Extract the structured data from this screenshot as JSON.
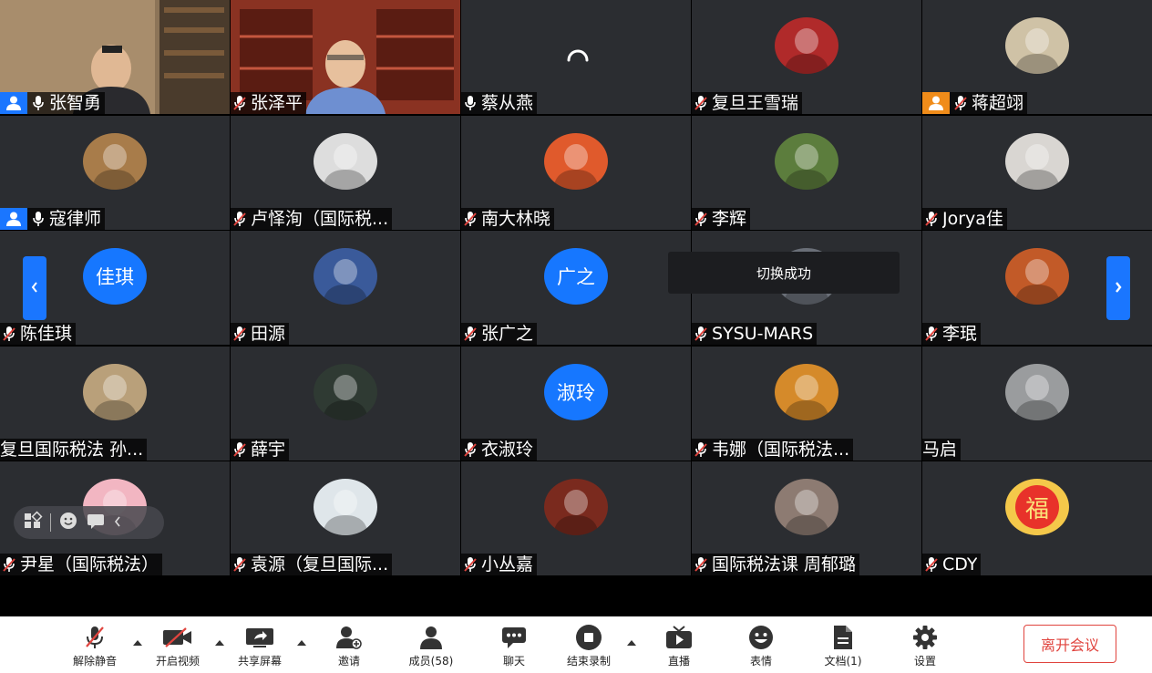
{
  "participants": [
    {
      "name": "张智勇",
      "host": "blue",
      "mic": "on",
      "media": "video1"
    },
    {
      "name": "张泽平",
      "host": "",
      "mic": "muted",
      "media": "video2"
    },
    {
      "name": "蔡从燕",
      "host": "",
      "mic": "on",
      "media": "loading"
    },
    {
      "name": "复旦王雪瑞",
      "host": "",
      "mic": "muted",
      "media": "avatar",
      "color": "#b02a2a"
    },
    {
      "name": "蒋超翊",
      "host": "orange",
      "mic": "muted",
      "media": "avatar",
      "color": "#cfc2a6"
    },
    {
      "name": "寇律师",
      "host": "blue",
      "mic": "on",
      "media": "avatar",
      "color": "#a87c4a"
    },
    {
      "name": "卢怿洵（国际税...",
      "host": "",
      "mic": "muted",
      "media": "avatar",
      "color": "#dddddd"
    },
    {
      "name": "南大林晓",
      "host": "",
      "mic": "muted",
      "media": "avatar",
      "color": "#e05a2c"
    },
    {
      "name": "李辉",
      "host": "",
      "mic": "muted",
      "media": "avatar",
      "color": "#5c7d3d"
    },
    {
      "name": "Jorya佳",
      "host": "",
      "mic": "muted",
      "media": "avatar",
      "color": "#d9d6d2"
    },
    {
      "name": "陈佳琪",
      "host": "",
      "mic": "muted",
      "media": "text",
      "text": "佳琪"
    },
    {
      "name": "田源",
      "host": "",
      "mic": "muted",
      "media": "avatar",
      "color": "#3a5a9a"
    },
    {
      "name": "张广之",
      "host": "",
      "mic": "muted",
      "media": "text",
      "text": "广之"
    },
    {
      "name": "SYSU-MARS",
      "host": "",
      "mic": "muted",
      "media": "avatar",
      "color": "#6a6f78"
    },
    {
      "name": "李珉",
      "host": "",
      "mic": "muted",
      "media": "avatar",
      "color": "#c25a28"
    },
    {
      "name": "复旦国际税法 孙...",
      "host": "",
      "mic": "none",
      "media": "avatar",
      "color": "#b9a07a"
    },
    {
      "name": "薛宇",
      "host": "",
      "mic": "muted",
      "media": "avatar",
      "color": "#2f3a33"
    },
    {
      "name": "衣淑玲",
      "host": "",
      "mic": "muted",
      "media": "text",
      "text": "淑玲"
    },
    {
      "name": "韦娜（国际税法...",
      "host": "",
      "mic": "muted",
      "media": "avatar",
      "color": "#d58a2a"
    },
    {
      "name": "马启",
      "host": "",
      "mic": "none",
      "media": "avatar",
      "color": "#9a9c9e"
    },
    {
      "name": "尹星（国际税法）",
      "host": "",
      "mic": "muted",
      "media": "avatar",
      "color": "#f2b6c2"
    },
    {
      "name": "袁源（复旦国际...",
      "host": "",
      "mic": "muted",
      "media": "avatar",
      "color": "#dfe6ea"
    },
    {
      "name": "小丛嘉",
      "host": "",
      "mic": "muted",
      "media": "avatar",
      "color": "#7a2a1e"
    },
    {
      "name": "国际税法课 周郁璐",
      "host": "",
      "mic": "muted",
      "media": "avatar",
      "color": "#8d7b72"
    },
    {
      "name": "CDY",
      "host": "",
      "mic": "muted",
      "media": "avatar",
      "color": "#e8322a",
      "glyph": "福"
    }
  ],
  "toast": "切换成功",
  "toolbar": {
    "mute": "解除静音",
    "video": "开启视频",
    "share": "共享屏幕",
    "invite": "邀请",
    "members": "成员(58)",
    "chat": "聊天",
    "record": "结束录制",
    "live": "直播",
    "emoji": "表情",
    "docs": "文档(1)",
    "settings": "设置",
    "leave": "离开会议"
  },
  "colors": {
    "accent": "#1a76ff",
    "leave": "#e0443e",
    "tile": "#2b2d31",
    "active_border": "#3ec24a"
  }
}
